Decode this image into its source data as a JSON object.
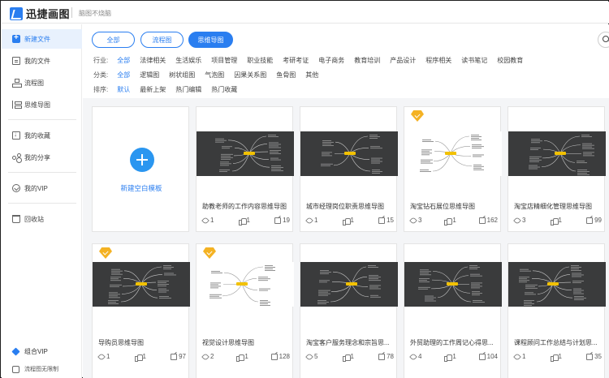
{
  "header": {
    "app_name": "迅捷画图",
    "slogan": "脑图不烧脑"
  },
  "sidebar": {
    "items": [
      {
        "label": "新建文件",
        "icon": "new-file-icon"
      },
      {
        "label": "我的文件",
        "icon": "file-icon"
      },
      {
        "label": "流程图",
        "icon": "flowchart-icon"
      },
      {
        "label": "思维导图",
        "icon": "mindmap-icon"
      },
      {
        "label": "我的收藏",
        "icon": "collect-icon"
      },
      {
        "label": "我的分享",
        "icon": "share-icon"
      },
      {
        "label": "我的VIP",
        "icon": "vip-icon"
      },
      {
        "label": "回收站",
        "icon": "trash-icon"
      }
    ],
    "vip_promo": "组合VIP",
    "cloud_note": "流程图无限制"
  },
  "tabs": [
    {
      "label": "全部"
    },
    {
      "label": "流程图"
    },
    {
      "label": "思维导图"
    }
  ],
  "filters": {
    "industry": {
      "label": "行业:",
      "options": [
        "全部",
        "法律相关",
        "生活娱乐",
        "项目管理",
        "职业技能",
        "考研考证",
        "电子商务",
        "教育培训",
        "产品设计",
        "程序相关",
        "读书笔记",
        "校园教育"
      ]
    },
    "category": {
      "label": "分类:",
      "options": [
        "全部",
        "逻辑图",
        "树状组图",
        "气泡图",
        "因果关系图",
        "鱼骨图",
        "其他"
      ]
    },
    "sort": {
      "label": "排序:",
      "options": [
        "默认",
        "最新上架",
        "热门编辑",
        "热门收藏"
      ]
    }
  },
  "new_template_label": "新建空白模板",
  "cards": [
    {
      "title": "助教老师的工作内容思维导图",
      "views": "1",
      "likes": "1",
      "uses": "19",
      "vip": false,
      "thumb": "dark"
    },
    {
      "title": "城市经理岗位职责思维导图",
      "views": "1",
      "likes": "1",
      "uses": "15",
      "vip": false,
      "thumb": "dark"
    },
    {
      "title": "淘宝钻石展位思维导图",
      "views": "3",
      "likes": "1",
      "uses": "162",
      "vip": true,
      "thumb": "light"
    },
    {
      "title": "淘宝店精细化管理思维导图",
      "views": "3",
      "likes": "1",
      "uses": "99",
      "vip": false,
      "thumb": "dark"
    },
    {
      "title": "导购员思维导图",
      "views": "1",
      "likes": "1",
      "uses": "97",
      "vip": true,
      "thumb": "dark"
    },
    {
      "title": "视觉设计思维导图",
      "views": "2",
      "likes": "1",
      "uses": "128",
      "vip": true,
      "thumb": "light"
    },
    {
      "title": "淘宝客户服务理念和宗旨思...",
      "views": "5",
      "likes": "1",
      "uses": "78",
      "vip": false,
      "thumb": "dark"
    },
    {
      "title": "外贸助理的工作周记心得思...",
      "views": "4",
      "likes": "1",
      "uses": "104",
      "vip": false,
      "thumb": "dark"
    },
    {
      "title": "课程顾问工作总结与计划思...",
      "views": "1",
      "likes": "1",
      "uses": "35",
      "vip": false,
      "thumb": "dark"
    }
  ],
  "colors": {
    "accent": "#2a7ef0",
    "vip": "#f4b223",
    "map_bg": "#3a3b3c",
    "node": "#f2c100"
  }
}
